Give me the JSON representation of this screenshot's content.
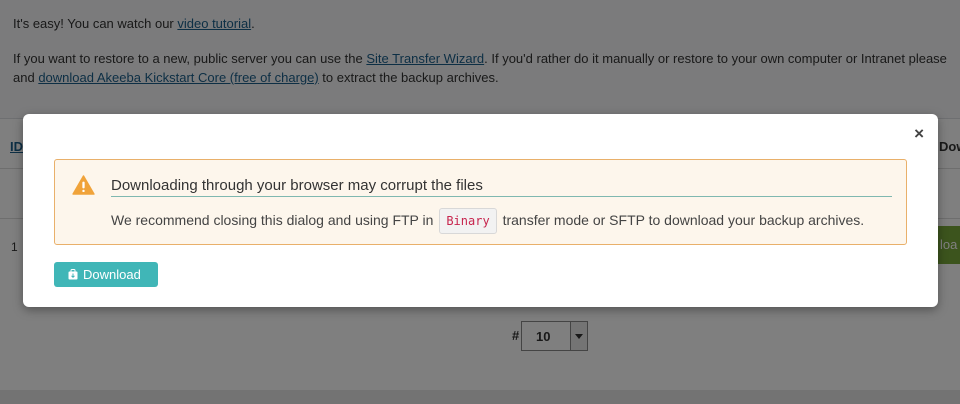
{
  "background": {
    "info": {
      "easy_prefix": "It's easy! You can watch our ",
      "easy_link": "video tutorial",
      "easy_suffix": ".",
      "restore_prefix": "If you want to restore to a new, public server you can use the ",
      "restore_link": "Site Transfer Wizard",
      "restore_suffix": ". If you'd rather do it manually or restore to your own computer or Intranet please",
      "kick_prefix": "and ",
      "kick_link": "download Akeeba Kickstart Core (free of charge)",
      "kick_suffix": " to extract the backup archives."
    },
    "table": {
      "col_id": "ID",
      "col_download": "Dow",
      "row_id": "1",
      "row_button": "loa"
    },
    "pagination": {
      "hash_label": "#",
      "limit_value": "10"
    }
  },
  "modal": {
    "close_symbol": "×",
    "alert": {
      "title": "Downloading through your browser may corrupt the files",
      "body_prefix": "We recommend closing this dialog and using FTP in ",
      "body_code": "Binary",
      "body_suffix": " transfer mode or SFTP to download your backup archives."
    },
    "download_button": "Download"
  },
  "colors": {
    "overlay": "rgba(0,0,0,0.5)",
    "alert_border": "#e9b06a",
    "alert_bg": "#fdf6ec",
    "warning_icon": "#f0a33a",
    "button": "#40b6b7",
    "green_button": "#79a83a",
    "link": "#1b5e8a"
  },
  "icons": {
    "warning": "warning-triangle-icon",
    "download": "download-icon",
    "select_arrow": "chevron-down-icon"
  }
}
